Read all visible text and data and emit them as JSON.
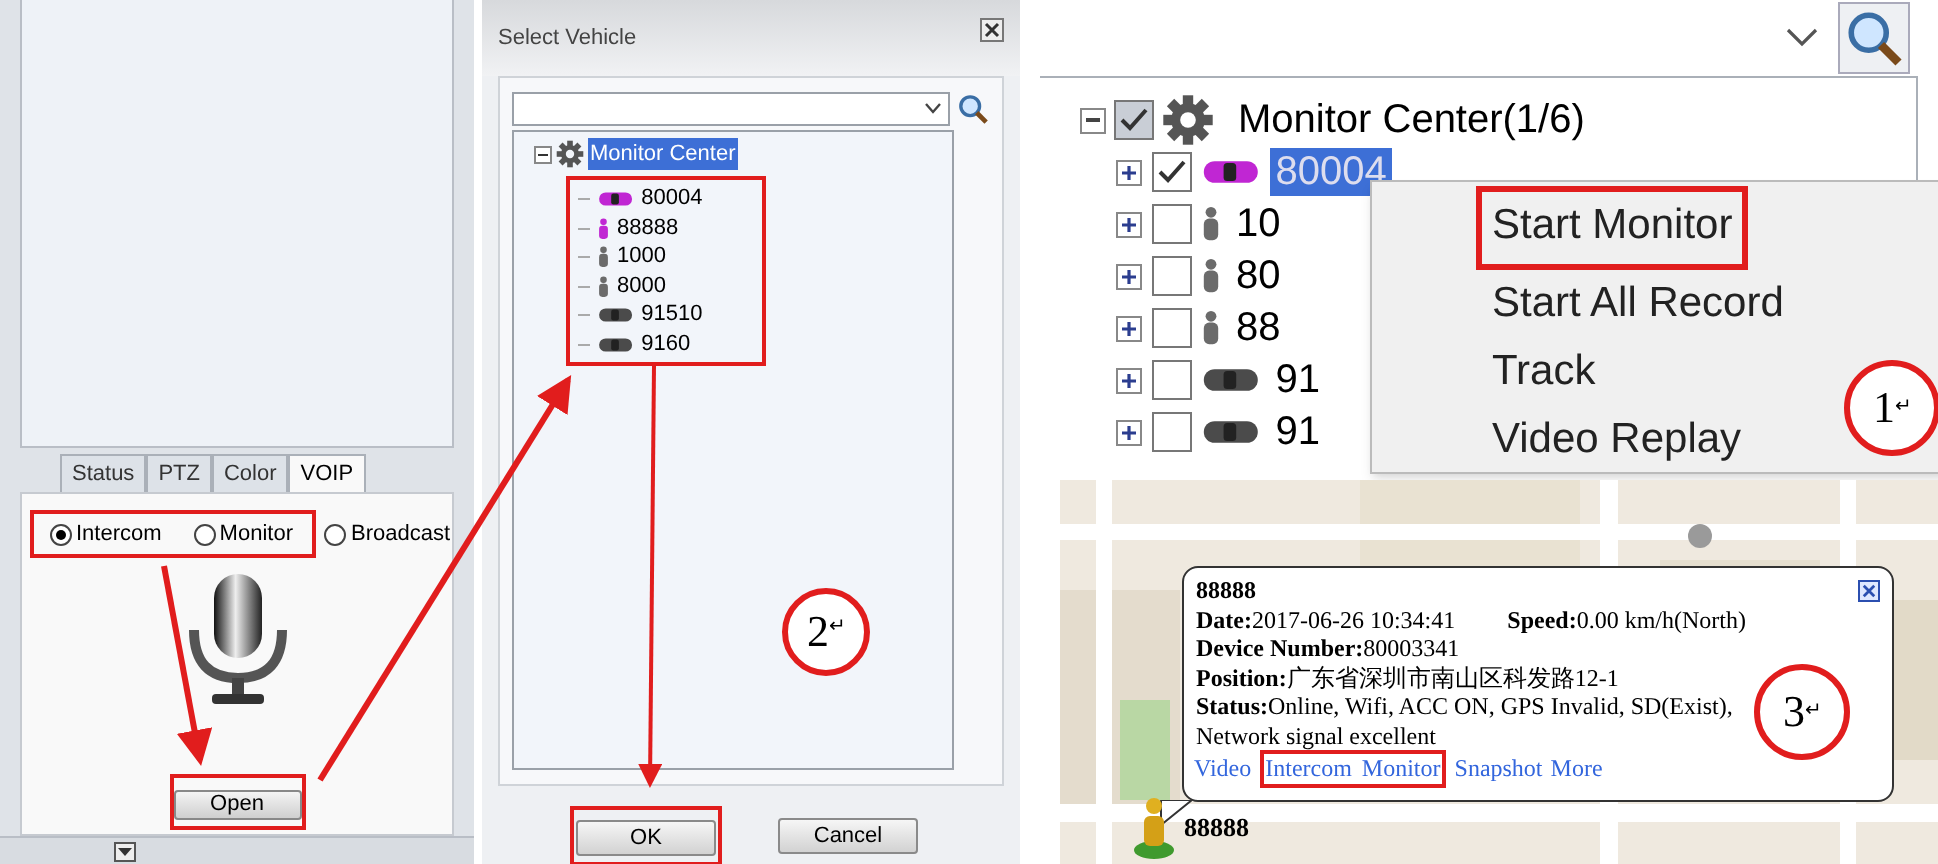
{
  "voip_panel": {
    "tabs": [
      {
        "label": "Status",
        "selected": false
      },
      {
        "label": "PTZ",
        "selected": false
      },
      {
        "label": "Color",
        "selected": false
      },
      {
        "label": "VOIP",
        "selected": true
      }
    ],
    "modes": [
      {
        "label": "Intercom",
        "selected": true,
        "highlighted": true
      },
      {
        "label": "Monitor",
        "selected": false,
        "highlighted": true
      },
      {
        "label": "Broadcast",
        "selected": false,
        "highlighted": false
      }
    ],
    "open_button": {
      "label": "Open",
      "highlighted": true
    }
  },
  "select_vehicle_dialog": {
    "title": "Select Vehicle",
    "tree": {
      "label": "Monitor Center",
      "selected": true,
      "children_highlighted": true,
      "children": [
        {
          "label": "80004",
          "kind": "car",
          "color": "#c026d3"
        },
        {
          "label": "88888",
          "kind": "person",
          "color": "#c026d3"
        },
        {
          "label": "1000",
          "kind": "person",
          "color": "#6b6b6b"
        },
        {
          "label": "8000",
          "kind": "person",
          "color": "#6b6b6b"
        },
        {
          "label": "91510",
          "kind": "car",
          "color": "#4b4b4b"
        },
        {
          "label": "9160",
          "kind": "car",
          "color": "#4b4b4b"
        }
      ]
    },
    "buttons": [
      {
        "label": "OK",
        "highlighted": true
      },
      {
        "label": "Cancel",
        "highlighted": false
      }
    ],
    "annotation": {
      "number": "2",
      "mark": "↵"
    }
  },
  "monitor_tree": {
    "root": {
      "label": "Monitor Center(1/6)",
      "checked": true,
      "children": [
        {
          "label": "80004",
          "checked": true,
          "selected": true,
          "kind": "car",
          "color": "#c026d3"
        },
        {
          "label": "10",
          "checked": false,
          "selected": false,
          "kind": "person",
          "color": "#6b6b6b"
        },
        {
          "label": "80",
          "checked": false,
          "selected": false,
          "kind": "person",
          "color": "#6b6b6b"
        },
        {
          "label": "88",
          "checked": false,
          "selected": false,
          "kind": "person",
          "color": "#6b6b6b"
        },
        {
          "label": "91",
          "checked": false,
          "selected": false,
          "kind": "car",
          "color": "#4b4b4b"
        },
        {
          "label": "91",
          "checked": false,
          "selected": false,
          "kind": "car",
          "color": "#4b4b4b"
        }
      ]
    }
  },
  "context_menu": {
    "items": [
      {
        "label": "Start Monitor",
        "highlighted": true
      },
      {
        "label": "Start All Record",
        "highlighted": false
      },
      {
        "label": "Track",
        "highlighted": false
      },
      {
        "label": "Video Replay",
        "highlighted": false
      }
    ],
    "annotation": {
      "number": "1",
      "mark": "↵"
    }
  },
  "map": {
    "kind": "picture",
    "marker_label": "88888",
    "popup": {
      "title": "88888",
      "rows": [
        [
          "**Date:**2017-06-26 10:34:41",
          "**Speed:**0.00 km/h(North)"
        ],
        [
          "**Device Number:**80003341"
        ],
        [
          "**Position:**广东省深圳市南山区科发路12-1"
        ],
        [
          "**Status:**Online, Wifi, ACC ON, GPS Invalid, SD(Exist), Network signal excellent"
        ]
      ],
      "links": [
        {
          "label": "Video",
          "highlighted": false
        },
        {
          "label": "Intercom",
          "highlighted": true
        },
        {
          "label": "Monitor",
          "highlighted": true
        },
        {
          "label": "Snapshot",
          "highlighted": false
        },
        {
          "label": "More",
          "highlighted": false
        }
      ]
    },
    "annotation": {
      "number": "3",
      "mark": "↵"
    }
  }
}
